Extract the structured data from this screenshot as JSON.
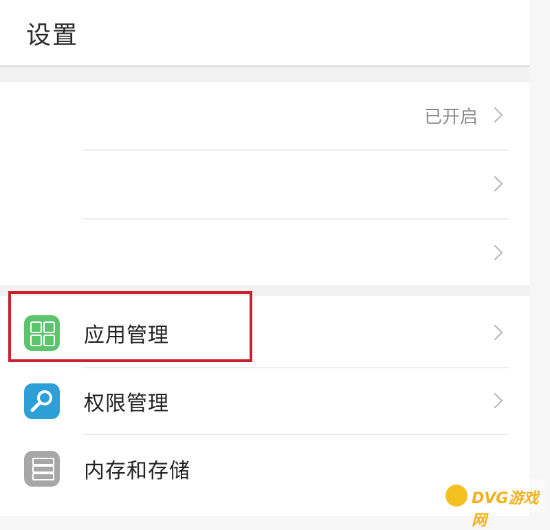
{
  "header": {
    "title": "设置"
  },
  "rows_group1": [
    {
      "label": "",
      "status": "已开启"
    },
    {
      "label": "",
      "status": ""
    },
    {
      "label": "",
      "status": ""
    }
  ],
  "rows_group2": [
    {
      "label": "应用管理",
      "icon": "apps-grid-icon"
    },
    {
      "label": "权限管理",
      "icon": "key-icon"
    },
    {
      "label": "内存和存储",
      "icon": "storage-icon"
    }
  ],
  "watermark": {
    "text": "DVG游戏网"
  },
  "colors": {
    "highlight": "#c8222c",
    "apps_icon": "#5cc46d",
    "key_icon": "#2e9fd6",
    "storage_icon": "#a7a7a7"
  }
}
